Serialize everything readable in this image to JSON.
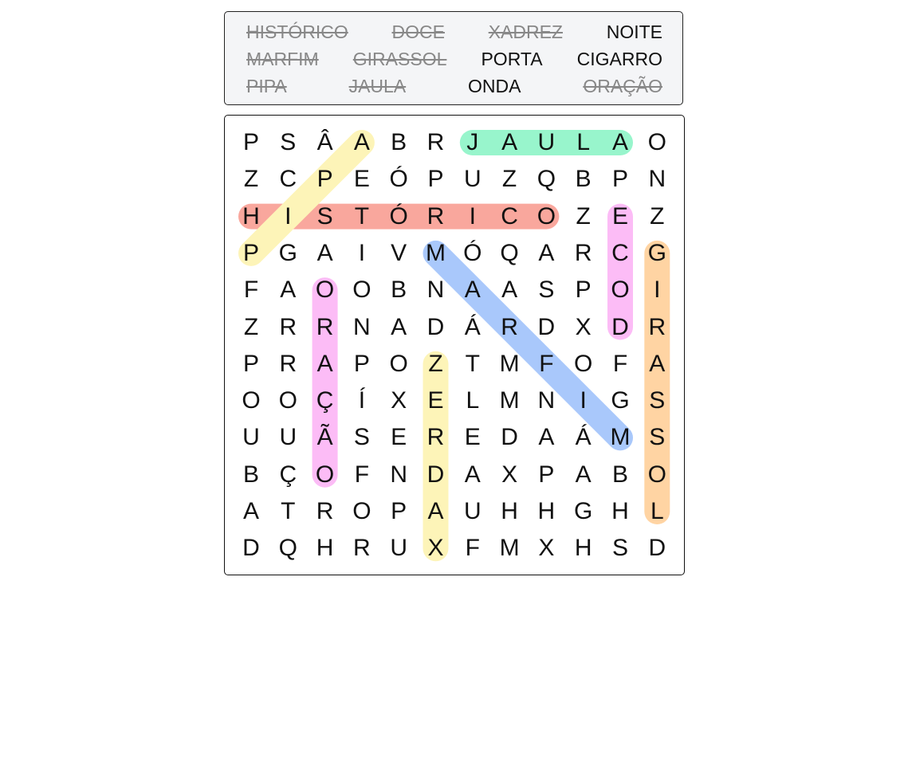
{
  "word_bank": {
    "rows": [
      [
        {
          "text": "HISTÓRICO",
          "found": true
        },
        {
          "text": "DOCE",
          "found": true
        },
        {
          "text": "XADREZ",
          "found": true
        },
        {
          "text": "NOITE",
          "found": false
        }
      ],
      [
        {
          "text": "MARFIM",
          "found": true
        },
        {
          "text": "GIRASSOL",
          "found": true
        },
        {
          "text": "PORTA",
          "found": false
        },
        {
          "text": "CIGARRO",
          "found": false
        }
      ],
      [
        {
          "text": "PIPA",
          "found": true
        },
        {
          "text": "JAULA",
          "found": true
        },
        {
          "text": "ONDA",
          "found": false
        },
        {
          "text": "ORAÇÃO",
          "found": true
        }
      ]
    ]
  },
  "grid": {
    "rows": [
      [
        "P",
        "S",
        "Â",
        "A",
        "B",
        "R",
        "J",
        "A",
        "U",
        "L",
        "A",
        "O"
      ],
      [
        "Z",
        "C",
        "P",
        "E",
        "Ó",
        "P",
        "U",
        "Z",
        "Q",
        "B",
        "P",
        "N"
      ],
      [
        "H",
        "I",
        "S",
        "T",
        "Ó",
        "R",
        "I",
        "C",
        "O",
        "Z",
        "E",
        "Z"
      ],
      [
        "P",
        "G",
        "A",
        "I",
        "V",
        "M",
        "Ó",
        "Q",
        "A",
        "R",
        "C",
        "G"
      ],
      [
        "F",
        "A",
        "O",
        "O",
        "B",
        "N",
        "A",
        "A",
        "S",
        "P",
        "O",
        "I"
      ],
      [
        "Z",
        "R",
        "R",
        "N",
        "A",
        "D",
        "Á",
        "R",
        "D",
        "X",
        "D",
        "R"
      ],
      [
        "P",
        "R",
        "A",
        "P",
        "O",
        "Z",
        "T",
        "M",
        "F",
        "O",
        "F",
        "A"
      ],
      [
        "O",
        "O",
        "Ç",
        "Í",
        "X",
        "E",
        "L",
        "M",
        "N",
        "I",
        "G",
        "S"
      ],
      [
        "U",
        "U",
        "Ã",
        "S",
        "E",
        "R",
        "E",
        "D",
        "A",
        "Á",
        "M",
        "S"
      ],
      [
        "B",
        "Ç",
        "O",
        "F",
        "N",
        "D",
        "A",
        "X",
        "P",
        "A",
        "B",
        "O"
      ],
      [
        "A",
        "T",
        "R",
        "O",
        "P",
        "A",
        "U",
        "H",
        "H",
        "G",
        "H",
        "L"
      ],
      [
        "D",
        "Q",
        "H",
        "R",
        "U",
        "X",
        "F",
        "M",
        "X",
        "H",
        "S",
        "D"
      ]
    ]
  },
  "found_words": [
    {
      "word": "HISTÓRICO",
      "start": [
        2,
        0
      ],
      "end": [
        2,
        8
      ],
      "color": "#f9a79d"
    },
    {
      "word": "JAULA",
      "start": [
        0,
        6
      ],
      "end": [
        0,
        10
      ],
      "color": "#98f5cc"
    },
    {
      "word": "PIPA",
      "start": [
        3,
        0
      ],
      "end": [
        0,
        3
      ],
      "color": "#fdf4b8"
    },
    {
      "word": "DOCE",
      "start": [
        5,
        10
      ],
      "end": [
        2,
        10
      ],
      "color": "#fcbcf6"
    },
    {
      "word": "GIRASSOL",
      "start": [
        3,
        11
      ],
      "end": [
        10,
        11
      ],
      "color": "#ffd4a3"
    },
    {
      "word": "ORAÇÃO",
      "start": [
        4,
        2
      ],
      "end": [
        9,
        2
      ],
      "color": "#fcbcf6"
    },
    {
      "word": "MARFIM",
      "start": [
        3,
        5
      ],
      "end": [
        8,
        10
      ],
      "color": "#a9c8fb"
    },
    {
      "word": "XADREZ",
      "start": [
        11,
        5
      ],
      "end": [
        6,
        5
      ],
      "color": "#fdf4b8"
    }
  ]
}
